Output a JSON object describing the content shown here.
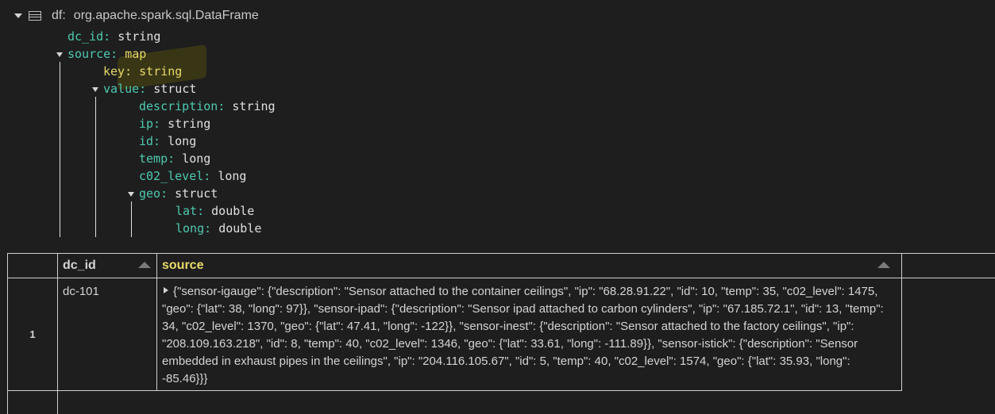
{
  "schema": {
    "df_label": "df:",
    "df_type": "org.apache.spark.sql.DataFrame",
    "fields": {
      "dc_id": {
        "name": "dc_id:",
        "type": "string"
      },
      "source": {
        "name": "source:",
        "type": "map"
      },
      "key": {
        "name": "key:",
        "type": "string"
      },
      "value": {
        "name": "value:",
        "type": "struct"
      },
      "description": {
        "name": "description:",
        "type": "string"
      },
      "ip": {
        "name": "ip:",
        "type": "string"
      },
      "id": {
        "name": "id:",
        "type": "long"
      },
      "temp": {
        "name": "temp:",
        "type": "long"
      },
      "c02_level": {
        "name": "c02_level:",
        "type": "long"
      },
      "geo": {
        "name": "geo:",
        "type": "struct"
      },
      "lat": {
        "name": "lat:",
        "type": "double"
      },
      "long": {
        "name": "long:",
        "type": "double"
      }
    }
  },
  "table": {
    "columns": [
      "dc_id",
      "source"
    ],
    "rows": [
      {
        "num": "1",
        "dc_id": "dc-101",
        "source": "{\"sensor-igauge\": {\"description\": \"Sensor attached to the container ceilings\", \"ip\": \"68.28.91.22\", \"id\": 10, \"temp\": 35, \"c02_level\": 1475, \"geo\": {\"lat\": 38, \"long\": 97}}, \"sensor-ipad\": {\"description\": \"Sensor ipad attached to carbon cylinders\", \"ip\": \"67.185.72.1\", \"id\": 13, \"temp\": 34, \"c02_level\": 1370, \"geo\": {\"lat\": 47.41, \"long\": -122}}, \"sensor-inest\": {\"description\": \"Sensor attached to the factory ceilings\", \"ip\": \"208.109.163.218\", \"id\": 8, \"temp\": 40, \"c02_level\": 1346, \"geo\": {\"lat\": 33.61, \"long\": -111.89}}, \"sensor-istick\": {\"description\": \"Sensor embedded in exhaust pipes in the ceilings\", \"ip\": \"204.116.105.67\", \"id\": 5, \"temp\": 40, \"c02_level\": 1574, \"geo\": {\"lat\": 35.93, \"long\": -85.46}}}"
      }
    ]
  },
  "icons": {
    "collapse": "chevron-down-icon",
    "table": "table-icon",
    "sort": "sort-icon",
    "expand_row": "chevron-right-icon"
  }
}
